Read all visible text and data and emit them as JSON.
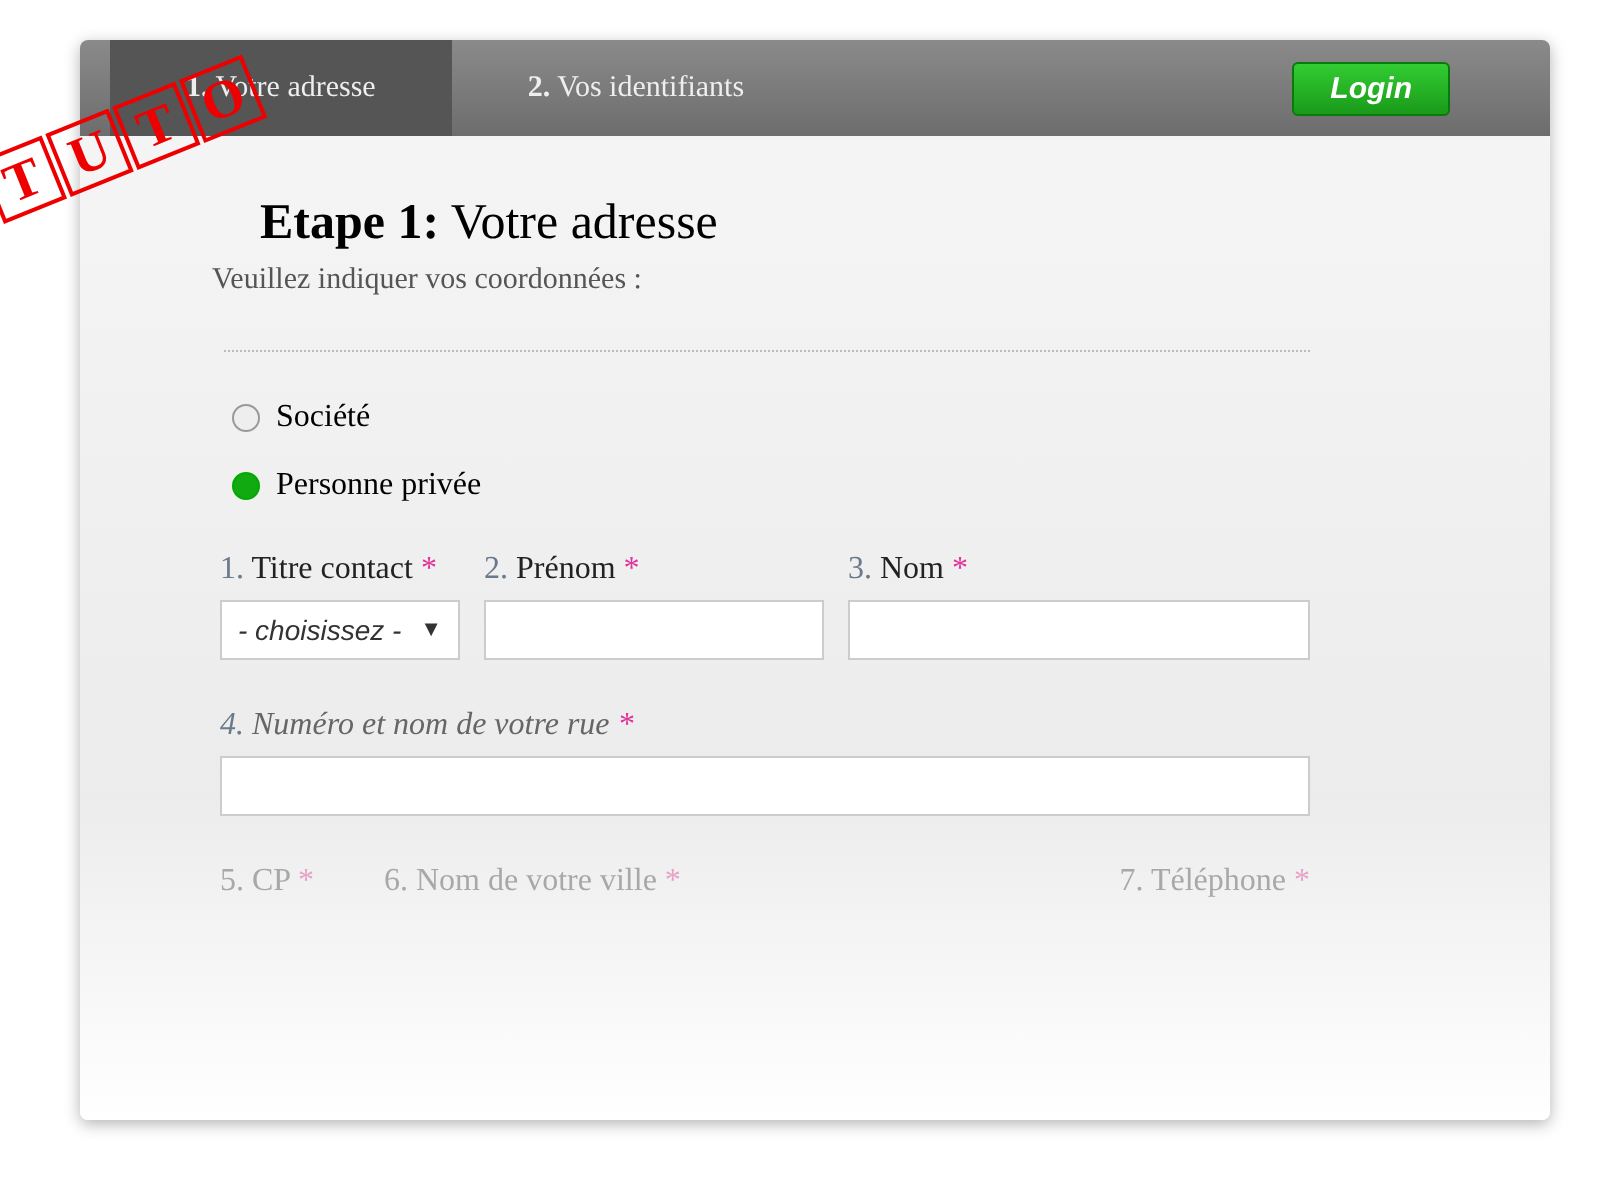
{
  "tabs": [
    {
      "number": "1.",
      "label": "Votre adresse",
      "selected": true
    },
    {
      "number": "2.",
      "label": "Vos identifiants",
      "selected": false
    }
  ],
  "login_button": "Login",
  "stamp": {
    "letters": [
      "T",
      "U",
      "T",
      "O"
    ]
  },
  "heading": {
    "step": "Etape 1:",
    "title": "Votre adresse"
  },
  "subtitle": "Veuillez indiquer vos coordonnées :",
  "customer_type": [
    {
      "label": "Société",
      "selected": false
    },
    {
      "label": "Personne privée",
      "selected": true
    }
  ],
  "rows": [
    {
      "faded": false,
      "fields": [
        {
          "number": "1.",
          "label": "Titre contact",
          "required_mark": "*",
          "kind": "select",
          "value": "- choisissez -",
          "caret": "▼"
        },
        {
          "number": "2.",
          "label": "Prénom",
          "required_mark": "*",
          "kind": "text"
        },
        {
          "number": "3.",
          "label": "Nom",
          "required_mark": "*",
          "kind": "text"
        }
      ]
    },
    {
      "faded": false,
      "fields": [
        {
          "number": "4.",
          "label": "Numéro et nom de votre rue",
          "required_mark": "*",
          "kind": "text"
        }
      ]
    },
    {
      "faded": true,
      "fields": [
        {
          "number": "5.",
          "label": "CP",
          "required_mark": "*",
          "kind": "label"
        },
        {
          "number": "6.",
          "label": "Nom de votre ville",
          "required_mark": "*",
          "kind": "label"
        },
        {
          "number": "7.",
          "label": "Téléphone",
          "required_mark": "*",
          "kind": "label"
        }
      ]
    }
  ]
}
